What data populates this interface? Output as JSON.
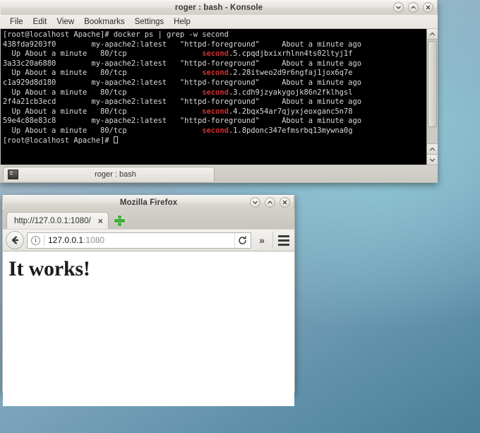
{
  "konsole": {
    "title": "roger : bash - Konsole",
    "menu": [
      "File",
      "Edit",
      "View",
      "Bookmarks",
      "Settings",
      "Help"
    ],
    "window_buttons": [
      {
        "name": "minimize",
        "glyph": "⌄"
      },
      {
        "name": "maximize",
        "glyph": "⌃"
      },
      {
        "name": "close",
        "glyph": "×"
      }
    ],
    "tab": {
      "label": "roger : bash",
      "icon": "terminal-icon"
    },
    "terminal": {
      "prompt": "[root@localhost Apache]# ",
      "command": "docker ps | grep -w second",
      "match_word": "second",
      "final_prompt": "[root@localhost Apache]# ",
      "rows": [
        {
          "container_id": "438fda9203f0",
          "image": "my-apache2:latest",
          "command": "\"httpd-foreground\"",
          "created": "About a minute ago",
          "status": "Up About a minute",
          "ports": "80/tcp",
          "task_index": ".5.",
          "task_suffix": "cpqdjbxixrhlnn4ts02ltyj1f"
        },
        {
          "container_id": "3a33c20a6880",
          "image": "my-apache2:latest",
          "command": "\"httpd-foreground\"",
          "created": "About a minute ago",
          "status": "Up About a minute",
          "ports": "80/tcp",
          "task_index": ".2.",
          "task_suffix": "28itweo2d9r6ngfaj1jox6q7e"
        },
        {
          "container_id": "c1a929d8d180",
          "image": "my-apache2:latest",
          "command": "\"httpd-foreground\"",
          "created": "About a minute ago",
          "status": "Up About a minute",
          "ports": "80/tcp",
          "task_index": ".3.",
          "task_suffix": "cdh9jzyakygojk86n2fklhgsl"
        },
        {
          "container_id": "2f4a21cb3ecd",
          "image": "my-apache2:latest",
          "command": "\"httpd-foreground\"",
          "created": "About a minute ago",
          "status": "Up About a minute",
          "ports": "80/tcp",
          "task_index": ".4.",
          "task_suffix": "2bqx54ar7qjyxjeoxganc5n78"
        },
        {
          "container_id": "59e4c88e83c8",
          "image": "my-apache2:latest",
          "command": "\"httpd-foreground\"",
          "created": "About a minute ago",
          "status": "Up About a minute",
          "ports": "80/tcp",
          "task_index": ".1.",
          "task_suffix": "8pdonc347efmsrbq13mywna0g"
        }
      ]
    },
    "colors": {
      "background": "#000000",
      "foreground": "#d8d8d8",
      "match": "#d03030"
    }
  },
  "firefox": {
    "title": "Mozilla Firefox",
    "window_buttons": [
      {
        "name": "minimize",
        "glyph": "⌄"
      },
      {
        "name": "maximize",
        "glyph": "⌃"
      },
      {
        "name": "close",
        "glyph": "×"
      }
    ],
    "tab": {
      "title": "http://127.0.0.1:1080/",
      "close_glyph": "×"
    },
    "new_tab_label": "+",
    "urlbar": {
      "host": "127.0.0.1",
      "port": ":1080",
      "identity_icon": "info-icon",
      "reload_label": "⟳"
    },
    "overflow_label": "»",
    "page": {
      "heading": "It works!"
    }
  },
  "desktop": {
    "background_top": "#b9c5cf",
    "background_bottom": "#4a7f98"
  }
}
